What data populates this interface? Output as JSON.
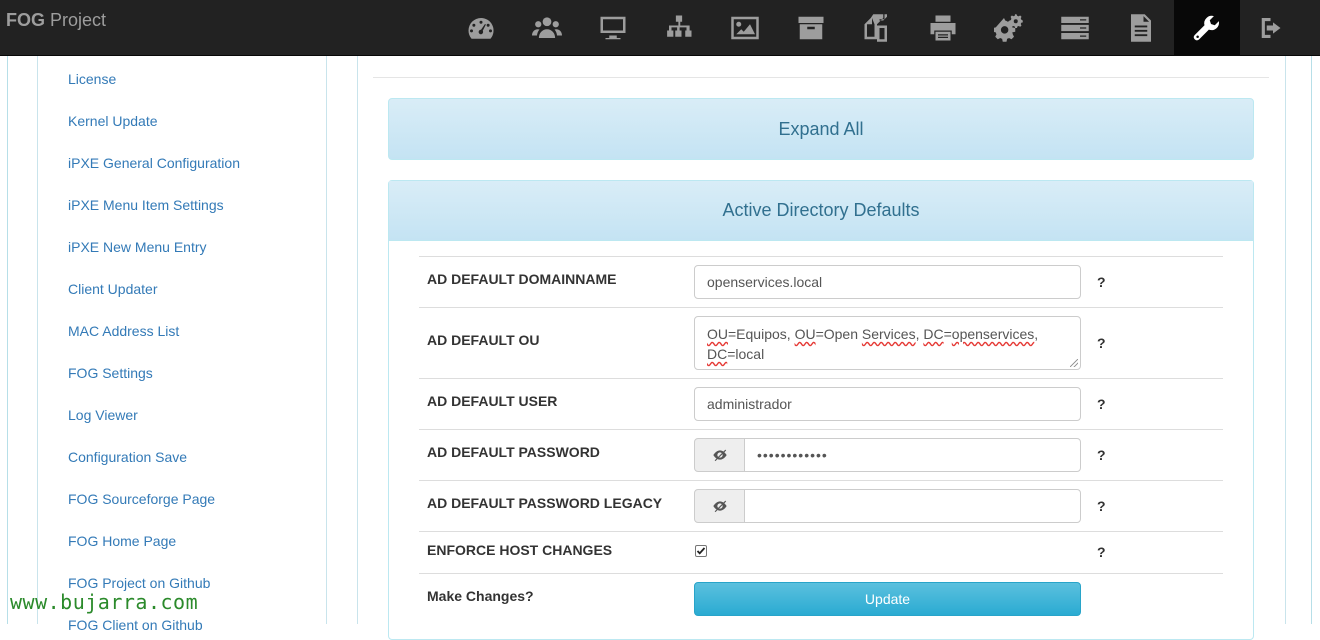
{
  "brand": {
    "bold": "FOG",
    "rest": " Project"
  },
  "nav": {
    "icons": [
      "dashboard-icon",
      "users-icon",
      "hosts-icon",
      "groups-icon",
      "images-icon",
      "storage-icon",
      "snapins-icon",
      "printers-icon",
      "service-icon",
      "tasks-icon",
      "reports-icon",
      "settings-icon",
      "logout-icon"
    ],
    "active": "settings-icon"
  },
  "sidebar": {
    "items": [
      {
        "label": "License"
      },
      {
        "label": "Kernel Update"
      },
      {
        "label": "iPXE General Configuration"
      },
      {
        "label": "iPXE Menu Item Settings"
      },
      {
        "label": "iPXE New Menu Entry"
      },
      {
        "label": "Client Updater"
      },
      {
        "label": "MAC Address List"
      },
      {
        "label": "FOG Settings"
      },
      {
        "label": "Log Viewer"
      },
      {
        "label": "Configuration Save"
      },
      {
        "label": "FOG Sourceforge Page"
      },
      {
        "label": "FOG Home Page"
      },
      {
        "label": "FOG Project on Github"
      },
      {
        "label": "FOG Client on Github"
      }
    ]
  },
  "expand_all": {
    "label": "Expand All"
  },
  "ad_panel": {
    "title": "Active Directory Defaults",
    "domainname": {
      "label": "AD DEFAULT DOMAINNAME",
      "value": "openservices.local",
      "help": "?"
    },
    "ou": {
      "label": "AD DEFAULT OU",
      "value_line1": [
        {
          "text": "OU",
          "squiggle": true
        },
        {
          "text": "=Equipos, ",
          "squiggle": false
        },
        {
          "text": "OU",
          "squiggle": true
        },
        {
          "text": "=Open ",
          "squiggle": false
        },
        {
          "text": "Services",
          "squiggle": true
        },
        {
          "text": ", ",
          "squiggle": false
        },
        {
          "text": "DC",
          "squiggle": true
        },
        {
          "text": "=",
          "squiggle": false
        },
        {
          "text": "openservices",
          "squiggle": true
        },
        {
          "text": ",",
          "squiggle": false
        }
      ],
      "value_line2": [
        {
          "text": "DC",
          "squiggle": true
        },
        {
          "text": "=local",
          "squiggle": false
        }
      ],
      "help": "?"
    },
    "user": {
      "label": "AD DEFAULT USER",
      "value": "administrador",
      "help": "?"
    },
    "password": {
      "label": "AD DEFAULT PASSWORD",
      "value": "••••••••••••",
      "help": "?"
    },
    "password_legacy": {
      "label": "AD DEFAULT PASSWORD LEGACY",
      "value": "",
      "help": "?"
    },
    "enforce": {
      "label": "ENFORCE HOST CHANGES",
      "checked": true,
      "help": "?"
    },
    "make_changes": {
      "label": "Make Changes?",
      "button": "Update"
    }
  },
  "watermark": "www.bujarra.com",
  "colors": {
    "accent": "#5bc0de",
    "link": "#337ab7",
    "panel_heading": "#d9edf7",
    "navbar": "#222222"
  }
}
